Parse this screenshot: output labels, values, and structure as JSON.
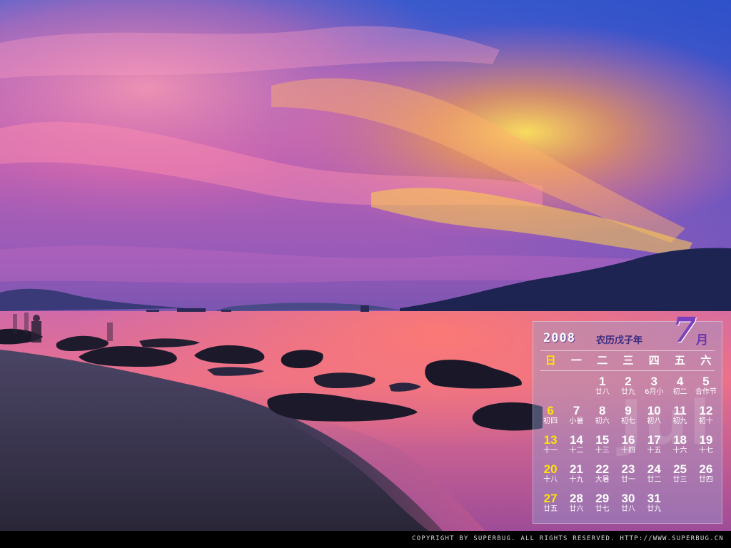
{
  "wallpaper": {
    "colors": {
      "sky_top": "#3d5fd0",
      "sky_pink": "#f06fa0",
      "sky_gold": "#ffd24a",
      "sea": "#e86a8a",
      "beach": "#3a3550",
      "mountain": "#1b2148"
    }
  },
  "calendar": {
    "year": "2008",
    "lunar_year": "农历戊子年",
    "month_number": "7",
    "month_unit": "月",
    "watermark": "Jul",
    "weekdays": [
      "日",
      "一",
      "二",
      "三",
      "四",
      "五",
      "六"
    ],
    "weeks": [
      [
        {
          "day": "",
          "lunar": ""
        },
        {
          "day": "",
          "lunar": ""
        },
        {
          "day": "1",
          "lunar": "廿八"
        },
        {
          "day": "2",
          "lunar": "廿九"
        },
        {
          "day": "3",
          "lunar": "6月小"
        },
        {
          "day": "4",
          "lunar": "初二"
        },
        {
          "day": "5",
          "lunar": "合作节"
        }
      ],
      [
        {
          "day": "6",
          "lunar": "初四"
        },
        {
          "day": "7",
          "lunar": "小暑"
        },
        {
          "day": "8",
          "lunar": "初六"
        },
        {
          "day": "9",
          "lunar": "初七"
        },
        {
          "day": "10",
          "lunar": "初八"
        },
        {
          "day": "11",
          "lunar": "初九"
        },
        {
          "day": "12",
          "lunar": "初十"
        }
      ],
      [
        {
          "day": "13",
          "lunar": "十一"
        },
        {
          "day": "14",
          "lunar": "十二"
        },
        {
          "day": "15",
          "lunar": "十三"
        },
        {
          "day": "16",
          "lunar": "十四"
        },
        {
          "day": "17",
          "lunar": "十五"
        },
        {
          "day": "18",
          "lunar": "十六"
        },
        {
          "day": "19",
          "lunar": "十七"
        }
      ],
      [
        {
          "day": "20",
          "lunar": "十八"
        },
        {
          "day": "21",
          "lunar": "十九"
        },
        {
          "day": "22",
          "lunar": "大暑"
        },
        {
          "day": "23",
          "lunar": "廿一"
        },
        {
          "day": "24",
          "lunar": "廿二"
        },
        {
          "day": "25",
          "lunar": "廿三"
        },
        {
          "day": "26",
          "lunar": "廿四"
        }
      ],
      [
        {
          "day": "27",
          "lunar": "廿五"
        },
        {
          "day": "28",
          "lunar": "廿六"
        },
        {
          "day": "29",
          "lunar": "廿七"
        },
        {
          "day": "30",
          "lunar": "廿八"
        },
        {
          "day": "31",
          "lunar": "廿九"
        },
        {
          "day": "",
          "lunar": ""
        },
        {
          "day": "",
          "lunar": ""
        }
      ]
    ]
  },
  "footer": {
    "copyright": "COPYRIGHT BY SUPERBUG. ALL RIGHTS RESERVED. HTTP://WWW.SUPERBUG.CN"
  }
}
